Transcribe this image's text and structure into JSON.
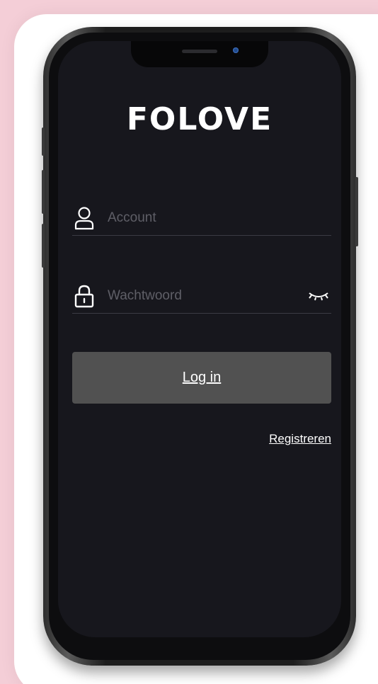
{
  "app": {
    "logo_text": "FOLOVE"
  },
  "login_form": {
    "account": {
      "placeholder": "Account",
      "value": ""
    },
    "password": {
      "placeholder": "Wachtwoord",
      "value": ""
    },
    "login_label": "Log in",
    "register_label": "Registreren"
  },
  "icons": {
    "account": "user-icon",
    "password": "lock-icon",
    "visibility": "eye-closed-icon"
  },
  "colors": {
    "background_pink": "#f4ced7",
    "screen_bg": "#17171d",
    "button_bg": "#515151",
    "text_primary": "#ffffff",
    "placeholder": "#5f5f67"
  }
}
